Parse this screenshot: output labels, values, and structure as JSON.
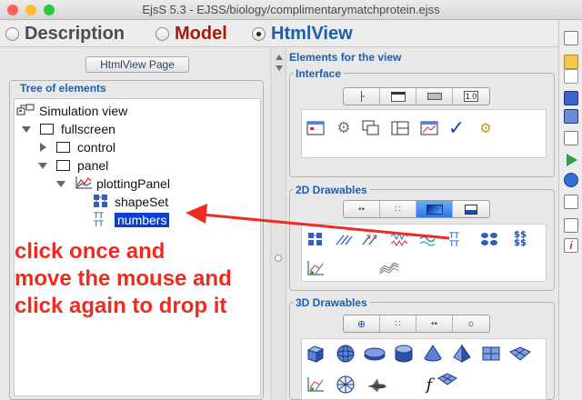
{
  "window": {
    "title": "EjsS 5.3 - EJSS/biology/complimentarymatchprotein.ejss"
  },
  "mode_tabs": [
    {
      "label": "Description",
      "selected": false,
      "color": "#4d4d4d"
    },
    {
      "label": "Model",
      "selected": false,
      "color": "#a61b0f"
    },
    {
      "label": "HtmlView",
      "selected": true,
      "color": "#1e5fa8"
    }
  ],
  "left_panel": {
    "page_button": "HtmlView Page",
    "tree_title": "Tree of elements",
    "tree": [
      {
        "label": "Simulation view",
        "icon": "simulation-view-icon",
        "expander": "none"
      },
      {
        "label": "fullscreen",
        "icon": "panel-box-icon",
        "expander": "expanded"
      },
      {
        "label": "control",
        "icon": "panel-box-icon",
        "expander": "collapsed"
      },
      {
        "label": "panel",
        "icon": "panel-box-icon",
        "expander": "expanded"
      },
      {
        "label": "plottingPanel",
        "icon": "plotting-panel-icon",
        "expander": "expanded"
      },
      {
        "label": "shapeSet",
        "icon": "shape-set-icon",
        "expander": "none"
      },
      {
        "label": "numbers",
        "icon": "text-set-icon",
        "expander": "none",
        "selected": true
      }
    ]
  },
  "right_panel": {
    "title": "Elements for the view",
    "groups": [
      {
        "label": "Interface",
        "tabs": [
          "tab-structure-icon",
          "tab-window-icon",
          "tab-button-icon",
          "tab-number-field-icon"
        ],
        "active_tab": -1,
        "items": [
          "frame-icon",
          "gear-icon",
          "window-stack-icon",
          "panel-layout-icon",
          "plot-window-icon",
          "checkmark-icon",
          "gear-small-icon"
        ]
      },
      {
        "label": "2D Drawables",
        "tabs": [
          "tab-points-icon",
          "tab-dots-icon",
          "tab-gradient-icon",
          "tab-field-icon"
        ],
        "active_tab": 2,
        "items": [
          "shape-set-icon",
          "segment-set-icon",
          "arrow-set-icon",
          "spring-set-icon",
          "image-set-icon",
          "text-set-icon",
          "ellipse-set-icon",
          "custom-set-icon",
          "trace-icon",
          "multi-trace-icon"
        ]
      },
      {
        "label": "3D Drawables",
        "tabs": [
          "tab-sphere-icon",
          "tab-dots-icon",
          "tab-points-icon",
          "tab-light-icon"
        ],
        "active_tab": -1,
        "items": [
          "cube-icon",
          "sphere-icon",
          "disk-icon",
          "cylinder-icon",
          "cone-icon",
          "pyramid-icon",
          "plane-icon",
          "surface-icon",
          "trace-3d-icon",
          "globe-icon",
          "shuttle-icon",
          "function-icon",
          "mesh-icon"
        ]
      }
    ]
  },
  "toolbar": {
    "icons": [
      "new-file-icon",
      "open-folder-icon",
      "open-file-icon",
      "save-icon",
      "save-as-icon",
      "search-file-icon",
      "run-icon",
      "web-icon",
      "library-icon",
      "preferences-icon",
      "info-icon"
    ]
  },
  "annotation": {
    "lines": [
      "click once and",
      "move the mouse and",
      "click again to drop it"
    ],
    "color": "#f02a1f"
  }
}
